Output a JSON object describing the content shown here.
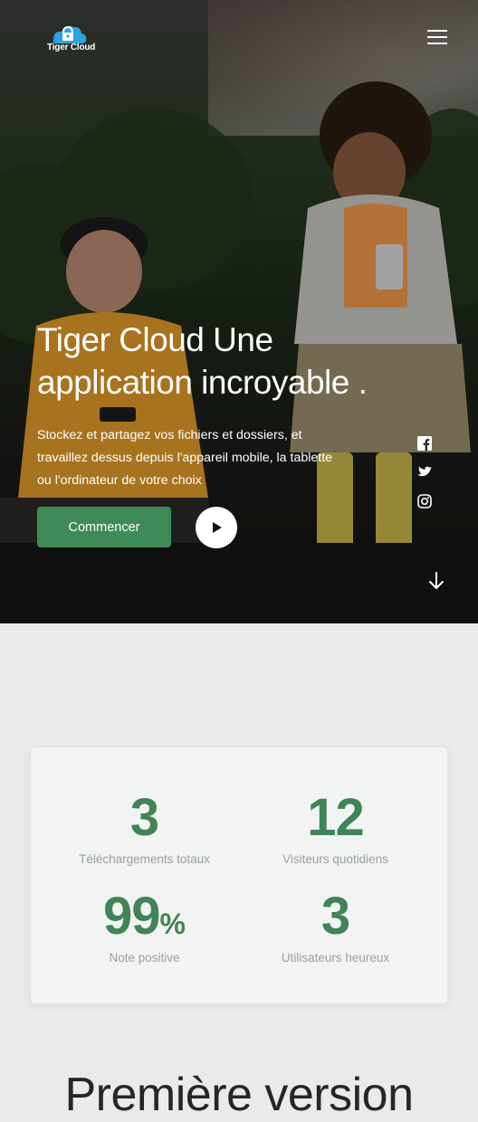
{
  "header": {
    "logo_text": "Tiger Cloud",
    "menu_icon": "hamburger-menu-icon"
  },
  "hero": {
    "headline_line1": "Tiger Cloud Une",
    "headline_line2": "application incroyable .",
    "description": "Stockez et partagez vos fichiers et dossiers, et travaillez dessus depuis l'appareil mobile, la tablette ou l'ordinateur de votre choix",
    "cta_label": "Commencer",
    "play_icon": "play-icon",
    "social_icons": [
      "facebook-icon",
      "twitter-icon",
      "instagram-icon"
    ],
    "scroll_icon": "arrow-down-icon"
  },
  "stats": [
    {
      "value": "3",
      "suffix": "",
      "label": "Téléchargements totaux"
    },
    {
      "value": "12",
      "suffix": "",
      "label": "Visiteurs quotidiens"
    },
    {
      "value": "99",
      "suffix": "%",
      "label": "Note positive"
    },
    {
      "value": "3",
      "suffix": "",
      "label": "Utilisateurs heureux"
    }
  ],
  "section": {
    "title": "Première version"
  },
  "colors": {
    "accent": "#3f8b57",
    "stat_number": "#3f8557",
    "logo_blue": "#2aa3e0"
  }
}
